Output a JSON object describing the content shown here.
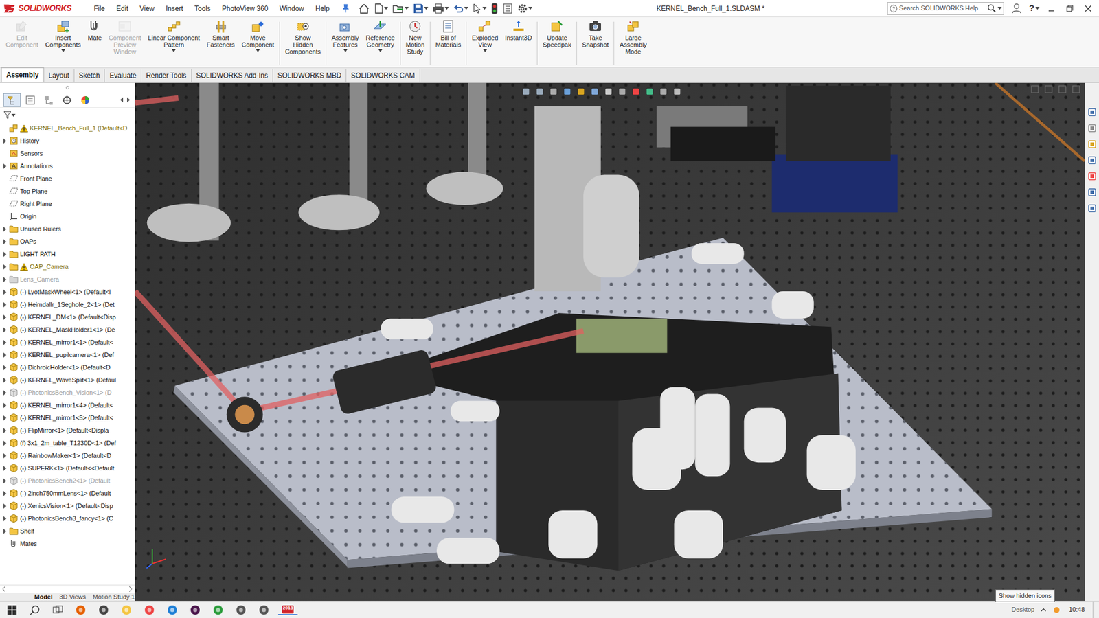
{
  "app": {
    "logo": "SOLIDWORKS"
  },
  "window": {
    "title": "KERNEL_Bench_Full_1.SLDASM *",
    "help": "?"
  },
  "menu": [
    "File",
    "Edit",
    "View",
    "Insert",
    "Tools",
    "PhotoView 360",
    "Window",
    "Help"
  ],
  "search": {
    "placeholder": "Search SOLIDWORKS Help"
  },
  "ribbon": [
    {
      "label": "Edit\nComponent",
      "disabled": true,
      "dropdown": false,
      "separator_before": false
    },
    {
      "label": "Insert\nComponents",
      "disabled": false,
      "dropdown": true,
      "separator_before": false
    },
    {
      "label": "Mate",
      "disabled": false,
      "dropdown": false,
      "separator_before": false
    },
    {
      "label": "Component\nPreview\nWindow",
      "disabled": true,
      "dropdown": false,
      "separator_before": false
    },
    {
      "label": "Linear Component\nPattern",
      "disabled": false,
      "dropdown": true,
      "separator_before": false
    },
    {
      "label": "Smart\nFasteners",
      "disabled": false,
      "dropdown": false,
      "separator_before": false
    },
    {
      "label": "Move\nComponent",
      "disabled": false,
      "dropdown": true,
      "separator_before": false
    },
    {
      "label": "Show\nHidden\nComponents",
      "disabled": false,
      "dropdown": false,
      "separator_before": true
    },
    {
      "label": "Assembly\nFeatures",
      "disabled": false,
      "dropdown": true,
      "separator_before": true
    },
    {
      "label": "Reference\nGeometry",
      "disabled": false,
      "dropdown": true,
      "separator_before": false
    },
    {
      "label": "New\nMotion\nStudy",
      "disabled": false,
      "dropdown": false,
      "separator_before": true
    },
    {
      "label": "Bill of\nMaterials",
      "disabled": false,
      "dropdown": false,
      "separator_before": true
    },
    {
      "label": "Exploded\nView",
      "disabled": false,
      "dropdown": true,
      "separator_before": true
    },
    {
      "label": "Instant3D",
      "disabled": false,
      "dropdown": false,
      "separator_before": false
    },
    {
      "label": "Update\nSpeedpak",
      "disabled": false,
      "dropdown": false,
      "separator_before": true
    },
    {
      "label": "Take\nSnapshot",
      "disabled": false,
      "dropdown": false,
      "separator_before": true
    },
    {
      "label": "Large\nAssembly\nMode",
      "disabled": false,
      "dropdown": false,
      "separator_before": true
    }
  ],
  "tabs": [
    {
      "label": "Assembly",
      "selected": true
    },
    {
      "label": "Layout",
      "selected": false
    },
    {
      "label": "Sketch",
      "selected": false
    },
    {
      "label": "Evaluate",
      "selected": false
    },
    {
      "label": "Render Tools",
      "selected": false
    },
    {
      "label": "SOLIDWORKS Add-Ins",
      "selected": false
    },
    {
      "label": "SOLIDWORKS MBD",
      "selected": false
    },
    {
      "label": "SOLIDWORKS CAM",
      "selected": false
    }
  ],
  "tree": {
    "items": [
      {
        "label": "KERNEL_Bench_Full_1  (Default<D",
        "kind": "assembly",
        "expandable": false,
        "warning": true,
        "suppressed": false
      },
      {
        "label": "History",
        "kind": "history",
        "expandable": true,
        "warning": false,
        "suppressed": false
      },
      {
        "label": "Sensors",
        "kind": "sensor",
        "expandable": false,
        "warning": false,
        "suppressed": false
      },
      {
        "label": "Annotations",
        "kind": "annotation",
        "expandable": true,
        "warning": false,
        "suppressed": false
      },
      {
        "label": "Front Plane",
        "kind": "plane",
        "expandable": false,
        "warning": false,
        "suppressed": false
      },
      {
        "label": "Top Plane",
        "kind": "plane",
        "expandable": false,
        "warning": false,
        "suppressed": false
      },
      {
        "label": "Right Plane",
        "kind": "plane",
        "expandable": false,
        "warning": false,
        "suppressed": false
      },
      {
        "label": "Origin",
        "kind": "origin",
        "expandable": false,
        "warning": false,
        "suppressed": false
      },
      {
        "label": "Unused Rulers",
        "kind": "folder",
        "expandable": true,
        "warning": false,
        "suppressed": false
      },
      {
        "label": "OAPs",
        "kind": "folder",
        "expandable": true,
        "warning": false,
        "suppressed": false
      },
      {
        "label": "LIGHT PATH",
        "kind": "folder",
        "expandable": true,
        "warning": false,
        "suppressed": false
      },
      {
        "label": "OAP_Camera",
        "kind": "folder",
        "expandable": true,
        "warning": true,
        "suppressed": false
      },
      {
        "label": "Lens_Camera",
        "kind": "folder",
        "expandable": true,
        "warning": false,
        "suppressed": true
      },
      {
        "label": "(-) LyotMaskWheel<1> (Default<l",
        "kind": "component",
        "expandable": true,
        "warning": false,
        "suppressed": false
      },
      {
        "label": "(-) Heimdallr_1Seghole_2<1> (Det",
        "kind": "component",
        "expandable": true,
        "warning": false,
        "suppressed": false
      },
      {
        "label": "(-) KERNEL_DM<1> (Default<Disp",
        "kind": "component",
        "expandable": true,
        "warning": false,
        "suppressed": false
      },
      {
        "label": "(-) KERNEL_MaskHolder1<1> (De",
        "kind": "component",
        "expandable": true,
        "warning": false,
        "suppressed": false
      },
      {
        "label": "(-) KERNEL_mirror1<1> (Default<",
        "kind": "component",
        "expandable": true,
        "warning": false,
        "suppressed": false
      },
      {
        "label": "(-) KERNEL_pupilcamera<1> (Def",
        "kind": "component",
        "expandable": true,
        "warning": false,
        "suppressed": false
      },
      {
        "label": "(-) DichroicHolder<1> (Default<D",
        "kind": "component",
        "expandable": true,
        "warning": false,
        "suppressed": false
      },
      {
        "label": "(-) KERNEL_WaveSplit<1> (Defaul",
        "kind": "component",
        "expandable": true,
        "warning": false,
        "suppressed": false
      },
      {
        "label": "(-) PhotonicsBench_Vision<1> (D",
        "kind": "component",
        "expandable": true,
        "warning": false,
        "suppressed": true
      },
      {
        "label": "(-) KERNEL_mirror1<4> (Default<",
        "kind": "component",
        "expandable": true,
        "warning": false,
        "suppressed": false
      },
      {
        "label": "(-) KERNEL_mirror1<5> (Default<",
        "kind": "component",
        "expandable": true,
        "warning": false,
        "suppressed": false
      },
      {
        "label": "(-) FlipMirror<1> (Default<Displa",
        "kind": "component",
        "expandable": true,
        "warning": false,
        "suppressed": false
      },
      {
        "label": "(f) 3x1_2m_table_T1230D<1> (Def",
        "kind": "component",
        "expandable": true,
        "warning": false,
        "suppressed": false
      },
      {
        "label": "(-) RainbowMaker<1> (Default<D",
        "kind": "component",
        "expandable": true,
        "warning": false,
        "suppressed": false
      },
      {
        "label": "(-) SUPERK<1> (Default<<Default",
        "kind": "component",
        "expandable": true,
        "warning": false,
        "suppressed": false
      },
      {
        "label": "(-) PhotonicsBench2<1> (Default",
        "kind": "component",
        "expandable": true,
        "warning": false,
        "suppressed": true
      },
      {
        "label": "(-) 2inch750mmLens<1> (Default",
        "kind": "component",
        "expandable": true,
        "warning": false,
        "suppressed": false
      },
      {
        "label": "(-) XenicsVision<1> (Default<Disp",
        "kind": "component",
        "expandable": true,
        "warning": false,
        "suppressed": false
      },
      {
        "label": "(-) PhotonicsBench3_fancy<1> (C",
        "kind": "component",
        "expandable": true,
        "warning": false,
        "suppressed": false
      },
      {
        "label": "Shelf",
        "kind": "folder",
        "expandable": true,
        "warning": false,
        "suppressed": false
      },
      {
        "label": "Mates",
        "kind": "mates",
        "expandable": false,
        "warning": false,
        "suppressed": false
      }
    ]
  },
  "bottom_tabs": [
    {
      "label": "Model",
      "selected": true
    },
    {
      "label": "3D Views",
      "selected": false
    },
    {
      "label": "Motion Study 1",
      "selected": false
    }
  ],
  "taskbar": {
    "badge": "2018",
    "desktop": "Desktop",
    "clock": "10:48",
    "tooltip": "Show hidden icons"
  }
}
